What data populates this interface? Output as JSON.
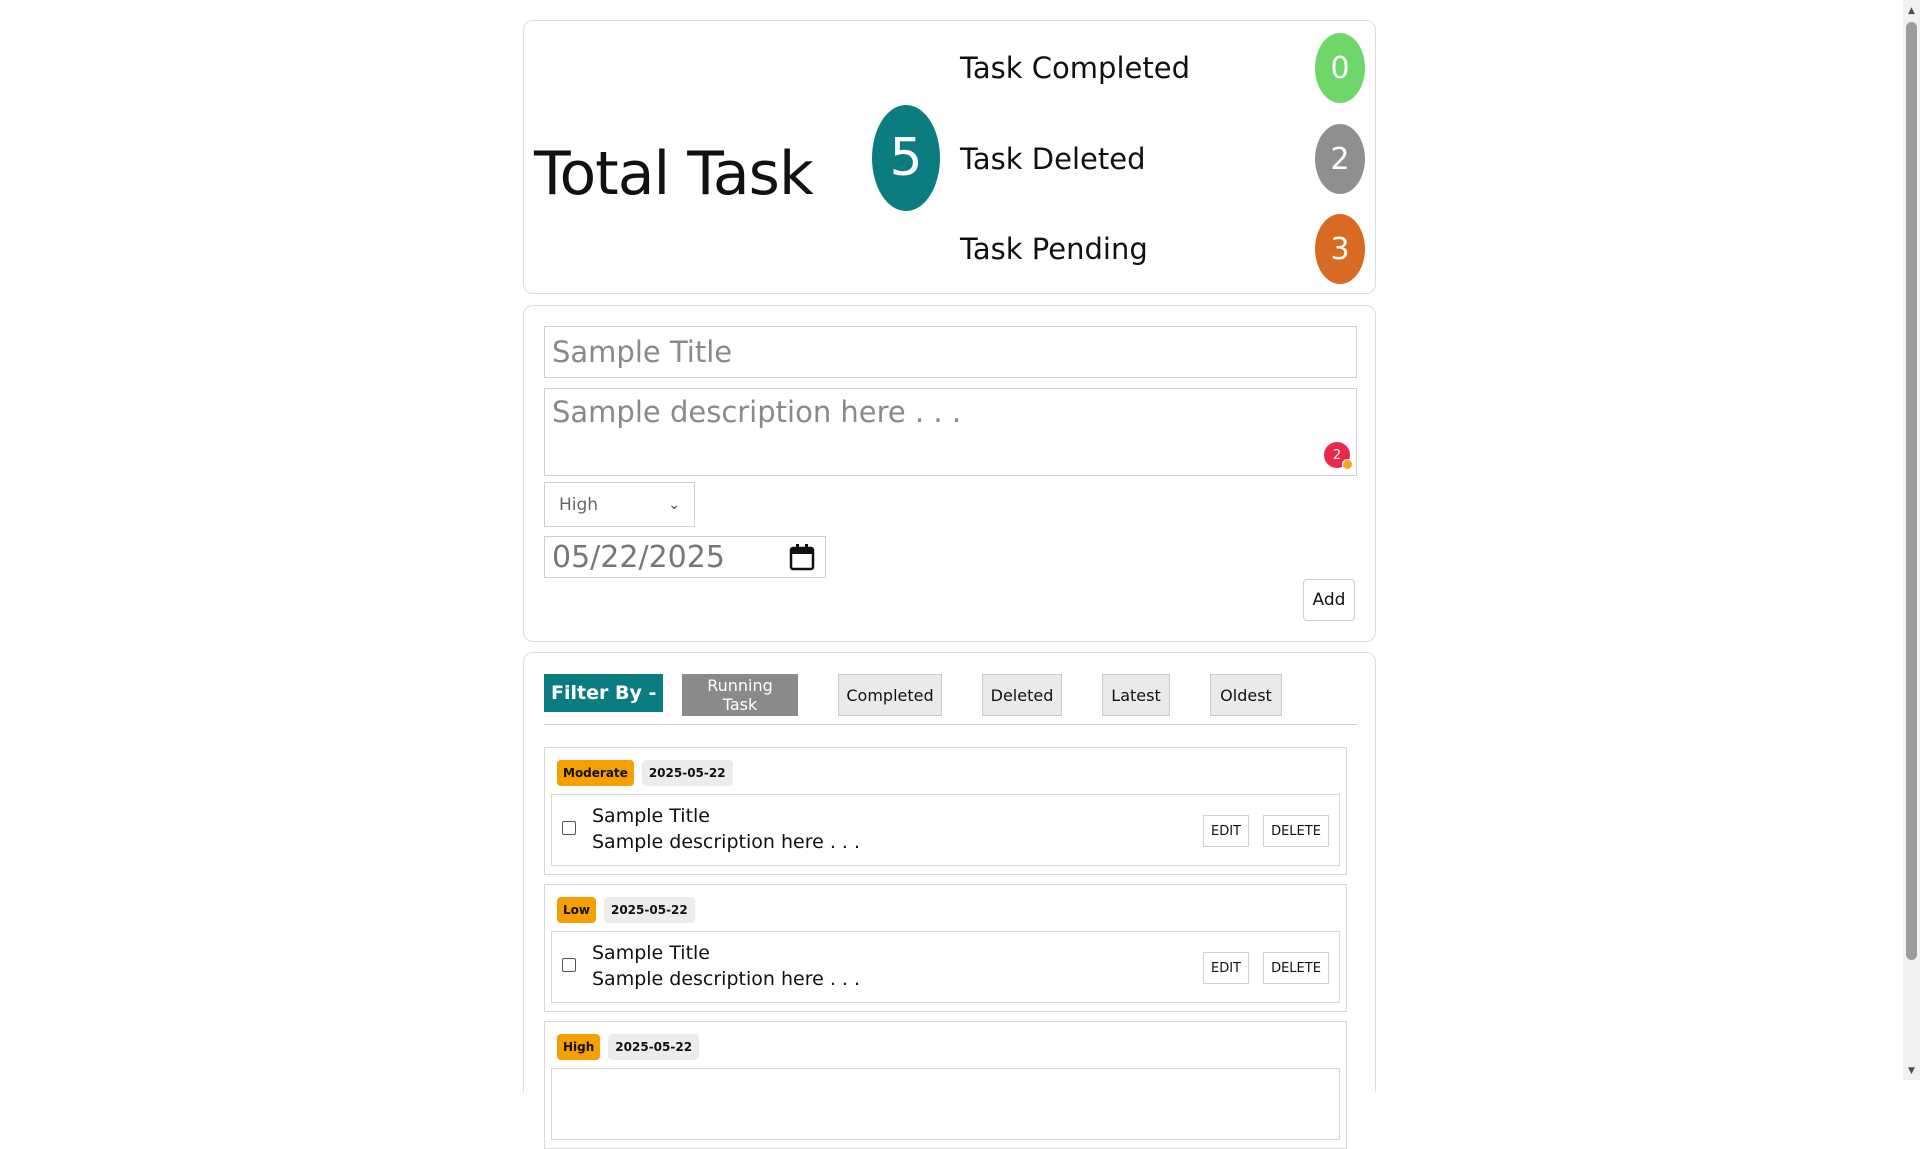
{
  "stats": {
    "total_label": "Total Task",
    "total_count": "5",
    "total_color": "#0b7d80",
    "rows": [
      {
        "label": "Task Completed",
        "count": "0",
        "color": "#6fd66a"
      },
      {
        "label": "Task Deleted",
        "count": "2",
        "color": "#8f8f8f"
      },
      {
        "label": "Task Pending",
        "count": "3",
        "color": "#d96a23"
      }
    ]
  },
  "form": {
    "title_placeholder": "Sample Title",
    "description_placeholder": "Sample description here . . .",
    "grammar_count": "2",
    "priority_value": "High",
    "date_value": "05/22/2025",
    "add_label": "Add"
  },
  "filter": {
    "label": "Filter By -",
    "buttons": [
      "Running Task",
      "Completed",
      "Deleted",
      "Latest",
      "Oldest"
    ],
    "active": "Running Task"
  },
  "tasks": [
    {
      "priority": "Moderate",
      "date": "2025-05-22",
      "title": "Sample Title",
      "description": "Sample description here . . .",
      "edit_label": "EDIT",
      "delete_label": "DELETE"
    },
    {
      "priority": "Low",
      "date": "2025-05-22",
      "title": "Sample Title",
      "description": "Sample description here . . .",
      "edit_label": "EDIT",
      "delete_label": "DELETE"
    },
    {
      "priority": "High",
      "date": "2025-05-22",
      "title": "",
      "description": "",
      "edit_label": "",
      "delete_label": ""
    }
  ],
  "colors": {
    "accent": "#0b7d80",
    "priority_badge": "#f5a000",
    "active_filter": "#8a8a8a"
  }
}
